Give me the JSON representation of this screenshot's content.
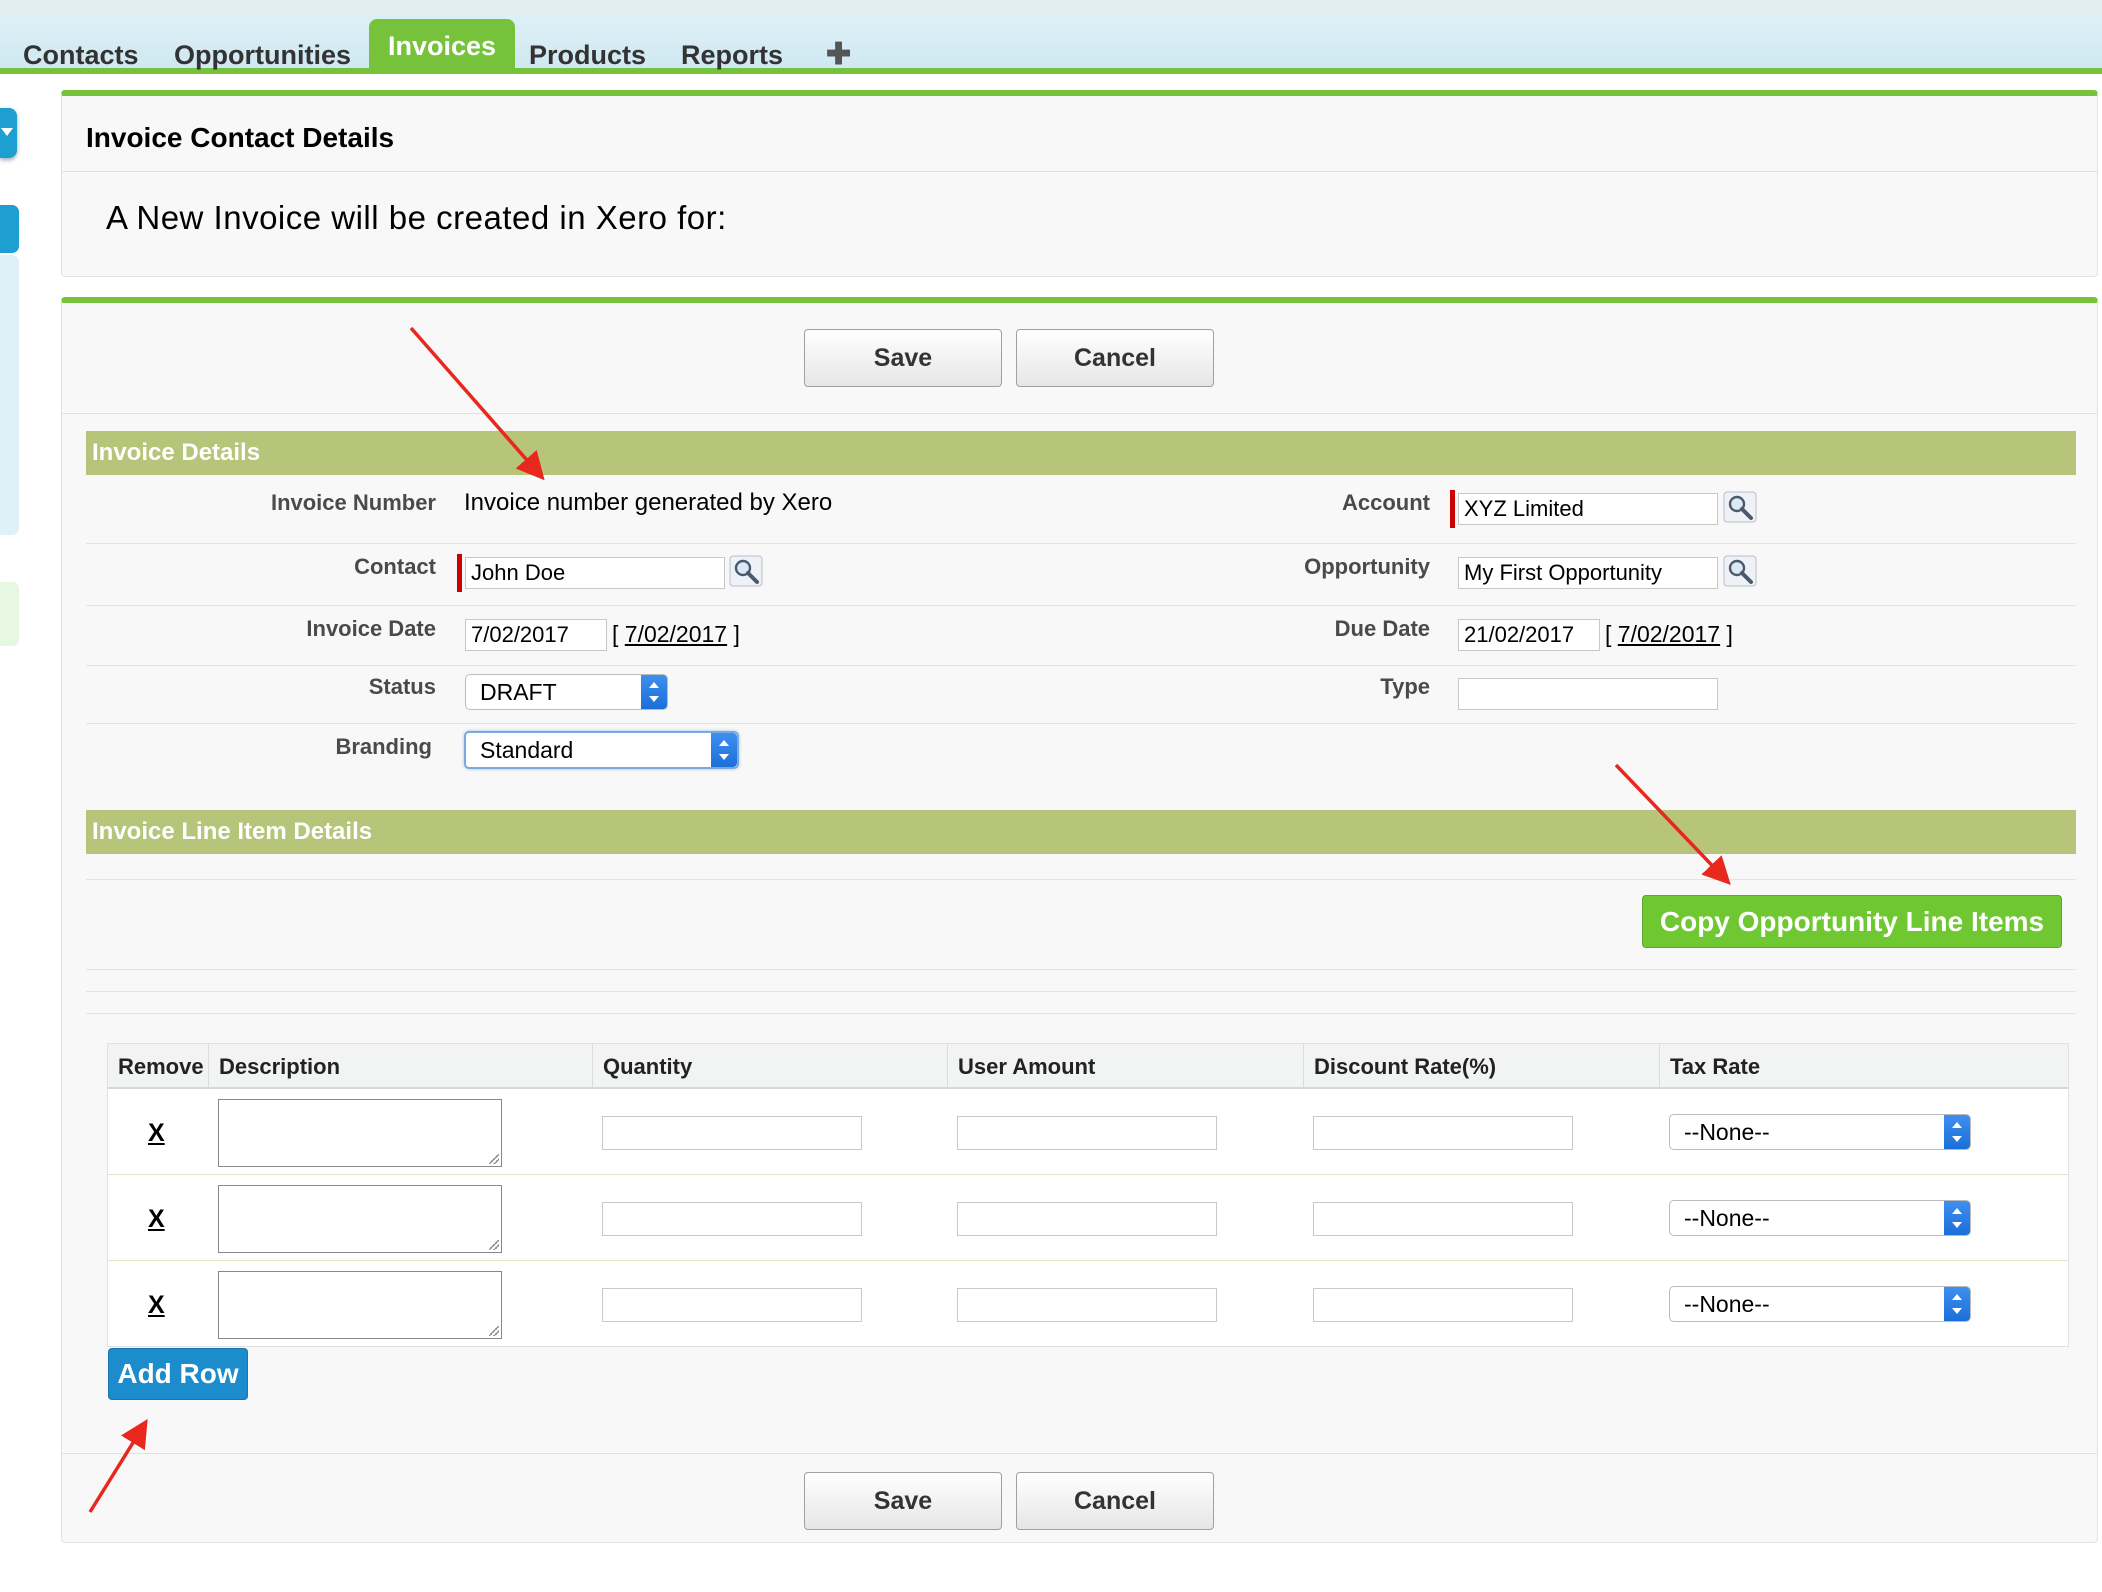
{
  "tabs": [
    {
      "label": "Contacts",
      "active": false
    },
    {
      "label": "Opportunities",
      "active": false
    },
    {
      "label": "Invoices",
      "active": true
    },
    {
      "label": "Products",
      "active": false
    },
    {
      "label": "Reports",
      "active": false
    },
    {
      "label": "✚",
      "active": false
    }
  ],
  "contact_panel": {
    "title": "Invoice Contact Details",
    "message": "A New Invoice will be created in Xero for:"
  },
  "buttons": {
    "save": "Save",
    "cancel": "Cancel",
    "copy_line_items": "Copy Opportunity Line Items",
    "add_row": "Add Row"
  },
  "invoice_details": {
    "section_title": "Invoice Details",
    "invoice_number_label": "Invoice Number",
    "invoice_number_value": "Invoice number generated by Xero",
    "contact_label": "Contact",
    "contact_value": "John Doe",
    "invoice_date_label": "Invoice Date",
    "invoice_date_value": "7/02/2017",
    "invoice_date_today": "7/02/2017",
    "status_label": "Status",
    "status_value": "DRAFT",
    "branding_label": "Branding",
    "branding_value": "Standard",
    "account_label": "Account",
    "account_value": "XYZ Limited",
    "opportunity_label": "Opportunity",
    "opportunity_value": "My First Opportunity",
    "due_date_label": "Due Date",
    "due_date_value": "21/02/2017",
    "due_date_today": "7/02/2017",
    "type_label": "Type",
    "type_value": ""
  },
  "line_items": {
    "section_title": "Invoice Line Item Details",
    "columns": [
      "Remove",
      "Description",
      "Quantity",
      "User Amount",
      "Discount Rate(%)",
      "Tax Rate"
    ],
    "rows": [
      {
        "remove": "X",
        "tax_rate": "--None--"
      },
      {
        "remove": "X",
        "tax_rate": "--None--"
      },
      {
        "remove": "X",
        "tax_rate": "--None--"
      }
    ]
  },
  "colors": {
    "accent_green": "#76c23b",
    "section_bar": "#b6c57a",
    "add_row_blue": "#1c8ccc",
    "annotation_red": "#e8281c"
  }
}
